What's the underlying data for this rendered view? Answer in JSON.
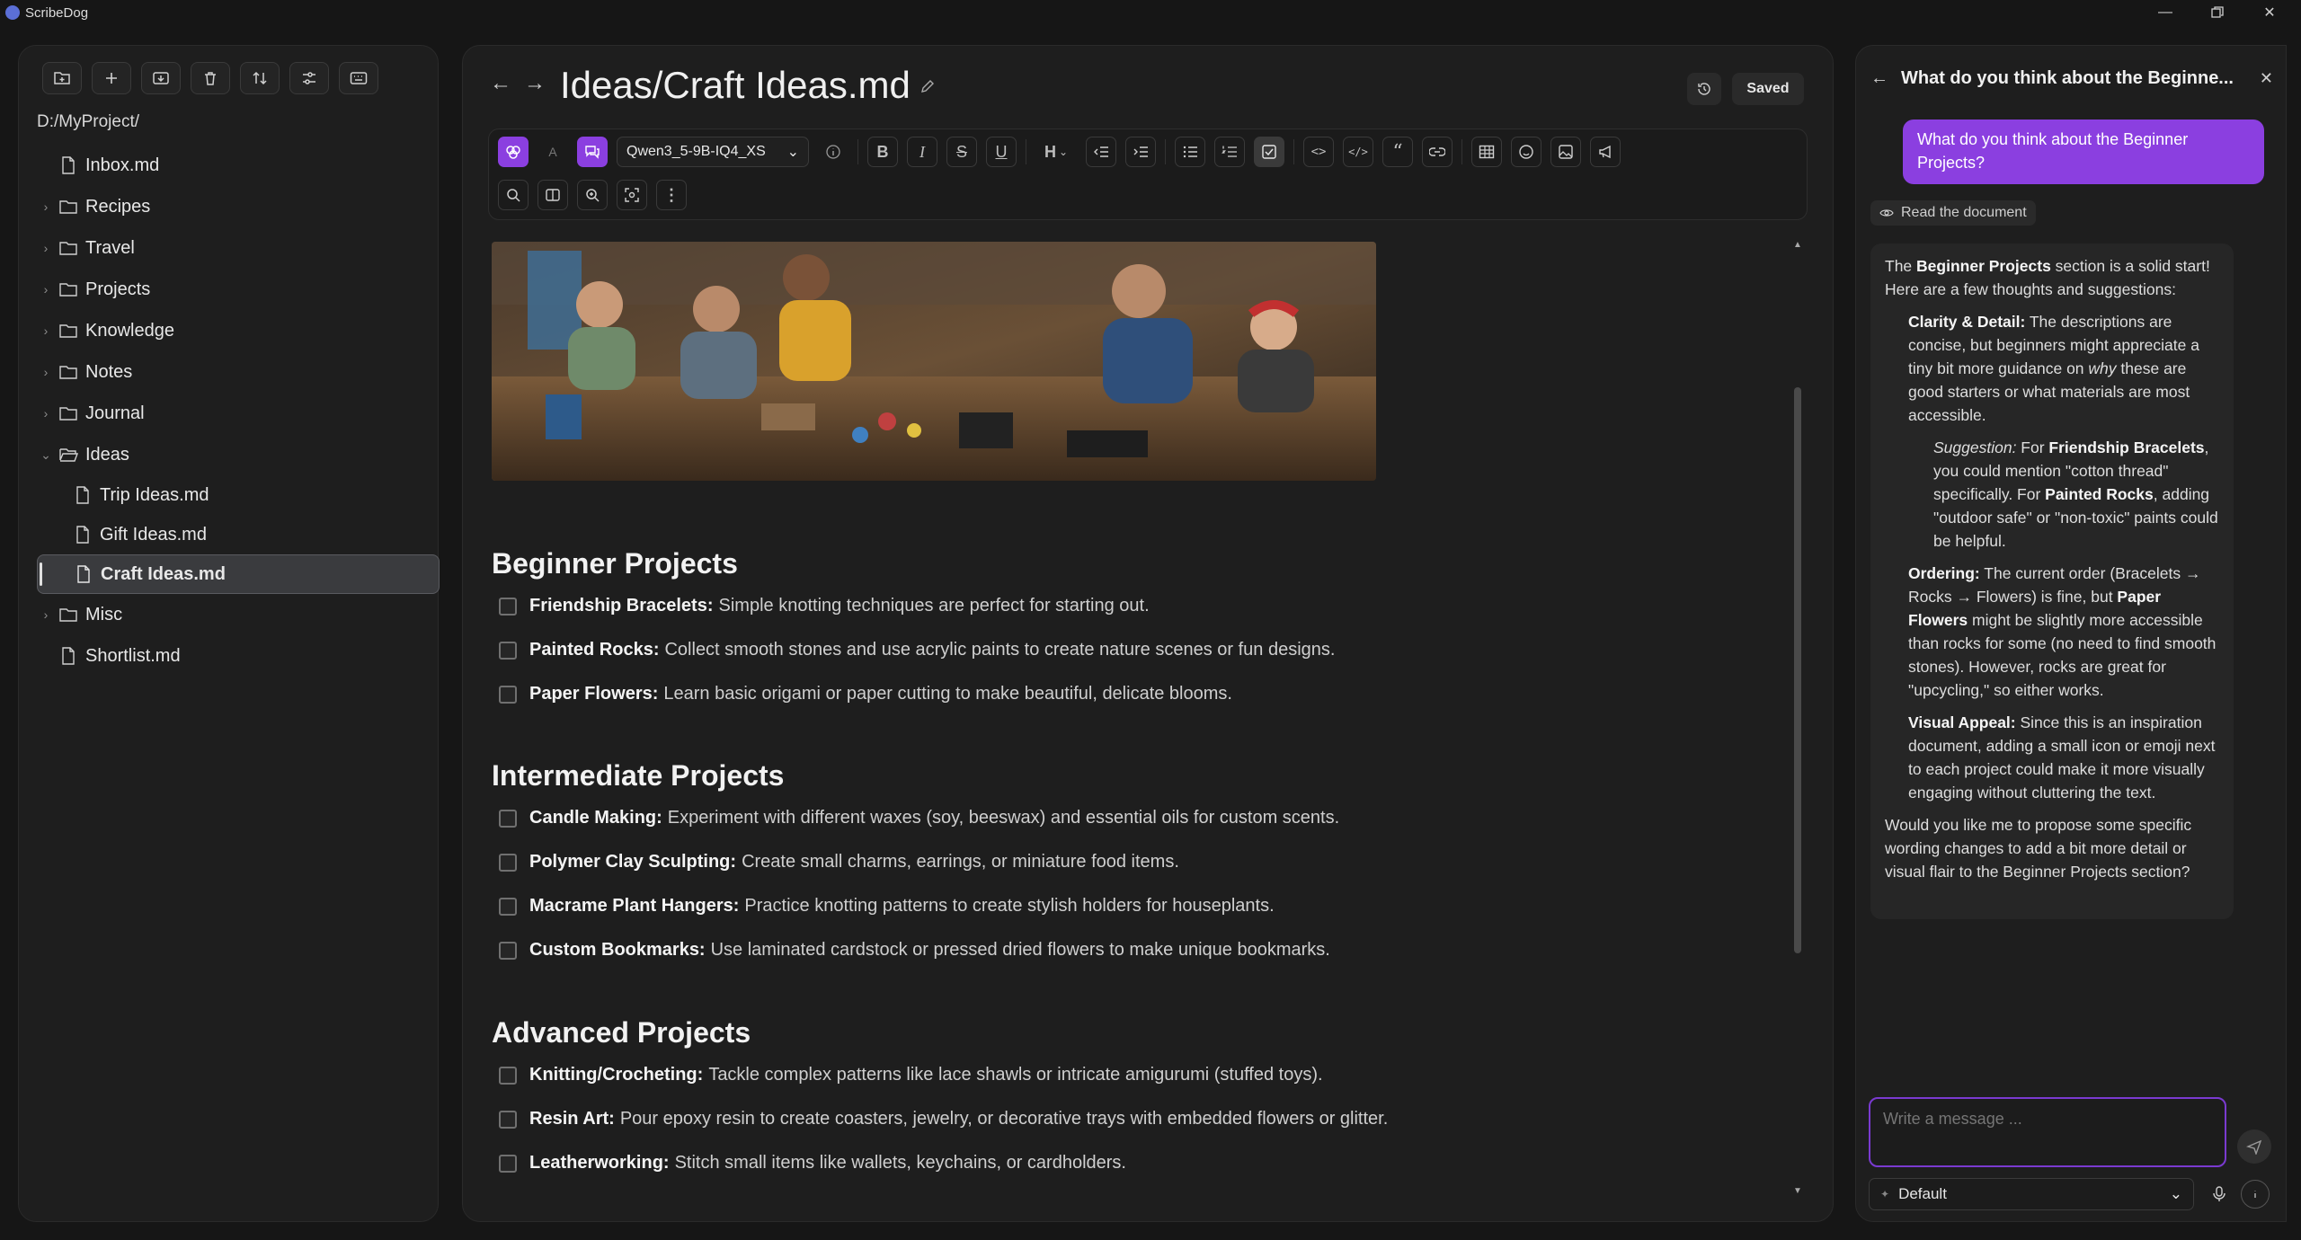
{
  "app": {
    "name": "ScribeDog"
  },
  "sidebar": {
    "path": "D:/MyProject/",
    "tools": [
      "new-folder-icon",
      "plus-icon",
      "import-icon",
      "trash-icon",
      "sort-icon",
      "filter-icon",
      "keyboard-icon"
    ],
    "items": [
      {
        "label": "Inbox.md",
        "type": "file"
      },
      {
        "label": "Recipes",
        "type": "folder"
      },
      {
        "label": "Travel",
        "type": "folder"
      },
      {
        "label": "Projects",
        "type": "folder"
      },
      {
        "label": "Knowledge",
        "type": "folder"
      },
      {
        "label": "Notes",
        "type": "folder"
      },
      {
        "label": "Journal",
        "type": "folder"
      },
      {
        "label": "Ideas",
        "type": "folder-open"
      },
      {
        "label": "Trip Ideas.md",
        "type": "file"
      },
      {
        "label": "Gift Ideas.md",
        "type": "file"
      },
      {
        "label": "Craft Ideas.md",
        "type": "file"
      },
      {
        "label": "Misc",
        "type": "folder"
      },
      {
        "label": "Shortlist.md",
        "type": "file"
      }
    ]
  },
  "editor": {
    "title": "Ideas/Craft Ideas.md",
    "saved_label": "Saved",
    "model": "Qwen3_5-9B-IQ4_XS",
    "sections": [
      {
        "heading": "Beginner Projects",
        "tasks": [
          {
            "name": "Friendship Bracelets:",
            "desc": "Simple knotting techniques are perfect for starting out."
          },
          {
            "name": "Painted Rocks:",
            "desc": "Collect smooth stones and use acrylic paints to create nature scenes or fun designs."
          },
          {
            "name": "Paper Flowers:",
            "desc": "Learn basic origami or paper cutting to make beautiful, delicate blooms."
          }
        ]
      },
      {
        "heading": "Intermediate Projects",
        "tasks": [
          {
            "name": "Candle Making:",
            "desc": "Experiment with different waxes (soy, beeswax) and essential oils for custom scents."
          },
          {
            "name": "Polymer Clay Sculpting:",
            "desc": "Create small charms, earrings, or miniature food items."
          },
          {
            "name": "Macrame Plant Hangers:",
            "desc": "Practice knotting patterns to create stylish holders for houseplants."
          },
          {
            "name": "Custom Bookmarks:",
            "desc": "Use laminated cardstock or pressed dried flowers to make unique bookmarks."
          }
        ]
      },
      {
        "heading": "Advanced Projects",
        "tasks": [
          {
            "name": "Knitting/Crocheting:",
            "desc": "Tackle complex patterns like lace shawls or intricate amigurumi (stuffed toys)."
          },
          {
            "name": "Resin Art:",
            "desc": "Pour epoxy resin to create coasters, jewelry, or decorative trays with embedded flowers or glitter."
          },
          {
            "name": "Leatherworking:",
            "desc": "Stitch small items like wallets, keychains, or cardholders."
          }
        ]
      }
    ]
  },
  "chat": {
    "title": "What do you think about the Beginne...",
    "user_message": "What do you think about the Beginner Projects?",
    "read_doc_label": "Read the document",
    "ai": {
      "p1_a": "The ",
      "p1_b": "Beginner Projects",
      "p1_c": " section is a solid start! Here are a few thoughts and suggestions:",
      "clarity_b": "Clarity & Detail:",
      "clarity_t1": " The descriptions are concise, but beginners might appreciate a tiny bit more guidance on ",
      "clarity_em": "why",
      "clarity_t2": " these are good starters or what materials are most accessible.",
      "sugg_em": "Suggestion:",
      "sugg_t1": " For ",
      "sugg_b1": "Friendship Bracelets",
      "sugg_t2": ", you could mention \"cotton thread\" specifically. For ",
      "sugg_b2": "Painted Rocks",
      "sugg_t3": ", adding \"outdoor safe\" or \"non-toxic\" paints could be helpful.",
      "order_b": "Ordering:",
      "order_t1": " The current order (Bracelets → Rocks → Flowers) is fine, but ",
      "order_b2": "Paper Flowers",
      "order_t2": " might be slightly more accessible than rocks for some (no need to find smooth stones). However, rocks are great for \"upcycling,\" so either works.",
      "visual_b": "Visual Appeal:",
      "visual_t": " Since this is an inspiration document, adding a small icon or emoji next to each project could make it more visually engaging without cluttering the text.",
      "closing": "Would you like me to propose some specific wording changes to add a bit more detail or visual flair to the Beginner Projects section?"
    },
    "input_placeholder": "Write a message ...",
    "mode": "Default"
  }
}
